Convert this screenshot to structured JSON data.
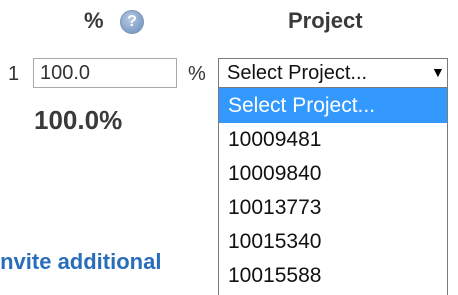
{
  "header": {
    "percent_label": "%",
    "help_icon": "question-mark-icon",
    "project_label": "Project"
  },
  "row": {
    "number": "1",
    "percent_value": "100.0",
    "percent_suffix": "%",
    "total": "100.0%"
  },
  "project_select": {
    "selected": "Select Project...",
    "arrow": "▼",
    "options": [
      "Select Project...",
      "10009481",
      "10009840",
      "10013773",
      "10015340",
      "10015588"
    ]
  },
  "link": {
    "label": "Invite additional"
  },
  "colors": {
    "selected_option_bg": "#3399ff",
    "link": "#2a6ebb",
    "help_icon": "#8aa8cc"
  }
}
